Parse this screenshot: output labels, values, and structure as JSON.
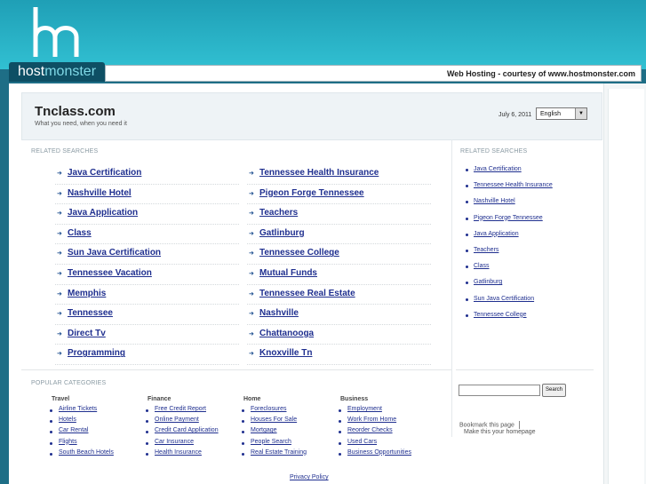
{
  "brand": {
    "host": "host",
    "monster": "monster",
    "hosting_note": "Web Hosting - courtesy of www.hostmonster.com",
    "colors": {
      "band": "#27b4c9",
      "dark": "#0e4f64",
      "link": "#1f2f8f"
    }
  },
  "header": {
    "title": "Tnclass.com",
    "subtitle": "What you need, when you need it",
    "date": "July 6, 2011",
    "language": "English"
  },
  "related_label": "RELATED SEARCHES",
  "main_links_left": [
    "Java Certification",
    "Nashville Hotel",
    "Java Application",
    "Class",
    "Sun Java Certification",
    "Tennessee Vacation",
    "Memphis",
    "Tennessee",
    "Direct Tv",
    "Programming"
  ],
  "main_links_right": [
    "Tennessee Health Insurance",
    "Pigeon Forge Tennessee",
    "Teachers",
    "Gatlinburg",
    "Tennessee College",
    "Mutual Funds",
    "Tennessee Real Estate",
    "Nashville",
    "Chattanooga",
    "Knoxville Tn"
  ],
  "side_links": [
    "Java Certification",
    "Tennessee Health Insurance",
    "Nashville Hotel",
    "Pigeon Forge Tennessee",
    "Java Application",
    "Teachers",
    "Class",
    "Gatlinburg",
    "Sun Java Certification",
    "Tennessee College"
  ],
  "popular_label": "POPULAR CATEGORIES",
  "categories": [
    {
      "title": "Travel",
      "items": [
        "Airline Tickets",
        "Hotels",
        "Car Rental",
        "Flights",
        "South Beach Hotels"
      ]
    },
    {
      "title": "Finance",
      "items": [
        "Free Credit Report",
        "Online Payment",
        "Credit Card Application",
        "Car Insurance",
        "Health Insurance"
      ]
    },
    {
      "title": "Home",
      "items": [
        "Foreclosures",
        "Houses For Sale",
        "Mortgage",
        "People Search",
        "Real Estate Training"
      ]
    },
    {
      "title": "Business",
      "items": [
        "Employment",
        "Work From Home",
        "Reorder Checks",
        "Used Cars",
        "Business Opportunities"
      ]
    }
  ],
  "search": {
    "button": "Search",
    "value": ""
  },
  "bookmark": "Bookmark this page",
  "homepage": "Make this your homepage",
  "privacy": "Privacy Policy"
}
